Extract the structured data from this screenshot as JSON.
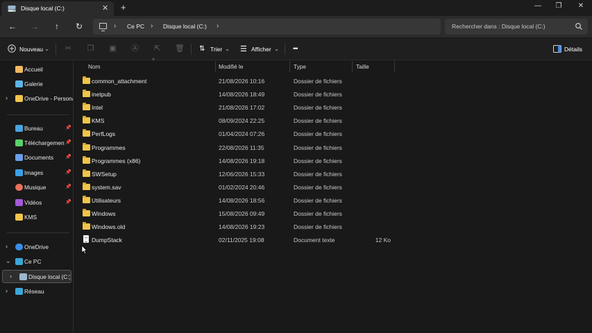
{
  "window": {
    "tab_title": "Disque local (C:)",
    "tab_close": "✕",
    "new_tab": "+",
    "minimize": "—",
    "maximize": "❐",
    "close": "✕"
  },
  "nav": {
    "back": "←",
    "forward": "→",
    "up": "↑",
    "refresh": "↻",
    "breadcrumbs": [
      "Ce PC",
      "Disque local (C:)"
    ],
    "search_placeholder": "Rechercher dans : Disque local (C:)"
  },
  "commands": {
    "new_label": "Nouveau",
    "sort_label": "Trier",
    "view_label": "Afficher",
    "more_label": "•••",
    "details_label": "Détails"
  },
  "sidebar": {
    "items": [
      {
        "label": "Accueil",
        "icon": "home-icon",
        "color": "#f4b860"
      },
      {
        "label": "Galerie",
        "icon": "gallery-icon",
        "color": "#5fb4e8"
      },
      {
        "label": "OneDrive - Personal",
        "icon": "folder-icon",
        "color": "#f0c54a"
      },
      {
        "label": "Bureau",
        "icon": "desktop-icon",
        "color": "#4aa4e0"
      },
      {
        "label": "Téléchargements",
        "icon": "download-icon",
        "color": "#5ad16a"
      },
      {
        "label": "Documents",
        "icon": "documents-icon",
        "color": "#6a9ee8"
      },
      {
        "label": "Images",
        "icon": "images-icon",
        "color": "#3aa0e8"
      },
      {
        "label": "Musique",
        "icon": "music-icon",
        "color": "#e8705a"
      },
      {
        "label": "Vidéos",
        "icon": "videos-icon",
        "color": "#a45ad8"
      },
      {
        "label": "KMS",
        "icon": "folder-icon",
        "color": "#f0c54a"
      },
      {
        "label": "OneDrive",
        "icon": "cloud-icon",
        "color": "#3a8ee8"
      },
      {
        "label": "Ce PC",
        "icon": "pc-icon",
        "color": "#3aa8d8"
      },
      {
        "label": "Disque local (C:)",
        "icon": "drive-icon",
        "color": "#9ab8d0"
      },
      {
        "label": "Réseau",
        "icon": "network-icon",
        "color": "#3aa8d8"
      }
    ]
  },
  "columns": {
    "name": "Nom",
    "modified": "Modifié le",
    "type": "Type",
    "size": "Taille"
  },
  "files": [
    {
      "name": "common_attachment",
      "modified": "21/08/2026 10:16",
      "type": "Dossier de fichiers",
      "size": "",
      "kind": "folder"
    },
    {
      "name": "inetpub",
      "modified": "14/08/2026 18:49",
      "type": "Dossier de fichiers",
      "size": "",
      "kind": "folder"
    },
    {
      "name": "Intel",
      "modified": "21/08/2026 17:02",
      "type": "Dossier de fichiers",
      "size": "",
      "kind": "folder"
    },
    {
      "name": "KMS",
      "modified": "08/09/2024 22:25",
      "type": "Dossier de fichiers",
      "size": "",
      "kind": "folder"
    },
    {
      "name": "PerfLogs",
      "modified": "01/04/2024 07:26",
      "type": "Dossier de fichiers",
      "size": "",
      "kind": "folder"
    },
    {
      "name": "Programmes",
      "modified": "22/08/2026 11:35",
      "type": "Dossier de fichiers",
      "size": "",
      "kind": "folder"
    },
    {
      "name": "Programmes (x86)",
      "modified": "14/08/2026 19:18",
      "type": "Dossier de fichiers",
      "size": "",
      "kind": "folder"
    },
    {
      "name": "SWSetup",
      "modified": "12/06/2026 15:33",
      "type": "Dossier de fichiers",
      "size": "",
      "kind": "folder"
    },
    {
      "name": "system.sav",
      "modified": "01/02/2024 20:46",
      "type": "Dossier de fichiers",
      "size": "",
      "kind": "folder"
    },
    {
      "name": "Utilisateurs",
      "modified": "14/08/2026 18:56",
      "type": "Dossier de fichiers",
      "size": "",
      "kind": "folder"
    },
    {
      "name": "Windows",
      "modified": "15/08/2026 09:49",
      "type": "Dossier de fichiers",
      "size": "",
      "kind": "folder"
    },
    {
      "name": "Windows.old",
      "modified": "14/08/2026 19:23",
      "type": "Dossier de fichiers",
      "size": "",
      "kind": "folder"
    },
    {
      "name": "DumpStack",
      "modified": "02/11/2025 19:08",
      "type": "Document texte",
      "size": "12 Ko",
      "kind": "text"
    }
  ]
}
